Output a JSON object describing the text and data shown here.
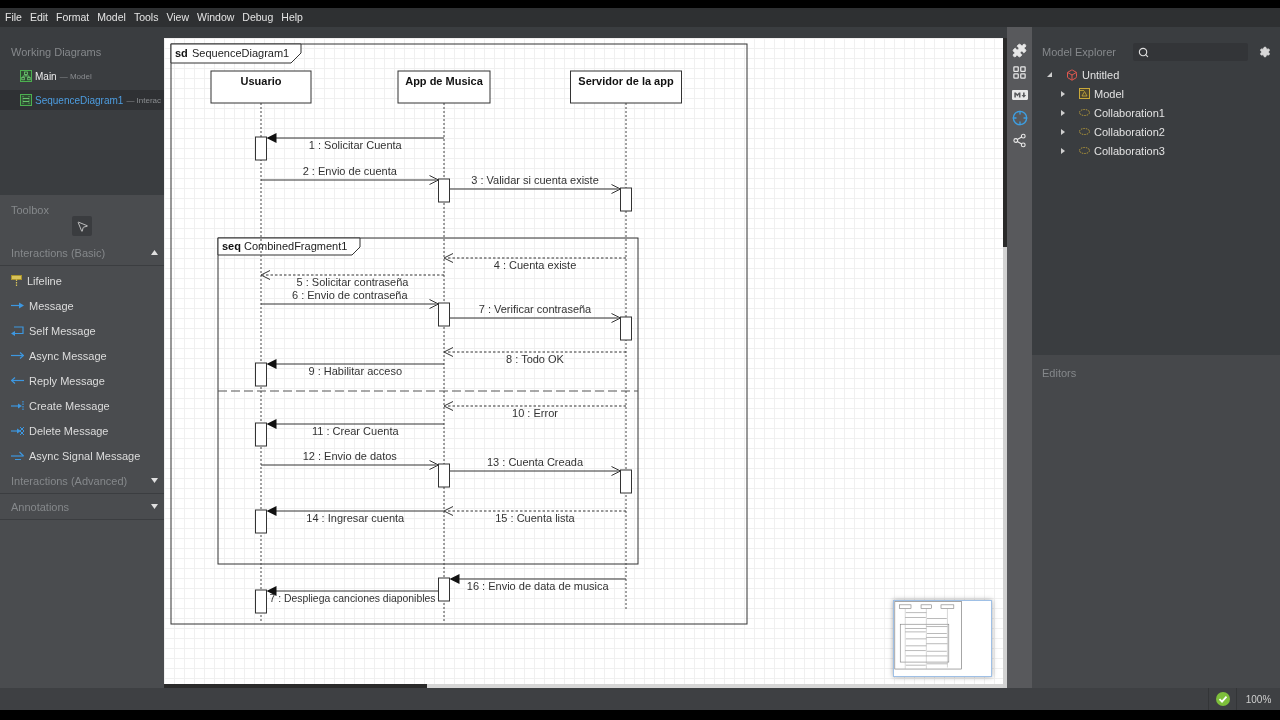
{
  "menu": [
    "File",
    "Edit",
    "Format",
    "Model",
    "Tools",
    "View",
    "Window",
    "Debug",
    "Help"
  ],
  "working_diagrams": {
    "title": "Working Diagrams",
    "items": [
      {
        "name": "Main",
        "type": "— Model",
        "kind": "model",
        "selected": false
      },
      {
        "name": "SequenceDiagram1",
        "type": "— Interac",
        "kind": "sequence",
        "selected": true
      }
    ]
  },
  "toolbox": {
    "title": "Toolbox",
    "sections": [
      {
        "title": "Interactions (Basic)",
        "expanded": true,
        "items": [
          {
            "label": "Lifeline",
            "kind": "lifeline"
          },
          {
            "label": "Message",
            "kind": "message"
          },
          {
            "label": "Self Message",
            "kind": "self"
          },
          {
            "label": "Async Message",
            "kind": "async"
          },
          {
            "label": "Reply Message",
            "kind": "reply"
          },
          {
            "label": "Create Message",
            "kind": "create"
          },
          {
            "label": "Delete Message",
            "kind": "delete"
          },
          {
            "label": "Async Signal Message",
            "kind": "signal"
          }
        ]
      },
      {
        "title": "Interactions (Advanced)",
        "expanded": false
      },
      {
        "title": "Annotations",
        "expanded": false
      }
    ]
  },
  "diagram": {
    "frame": {
      "keyword": "sd",
      "name": "SequenceDiagram1"
    },
    "lifelines": [
      {
        "name": "Usuario"
      },
      {
        "name": "App de Musica"
      },
      {
        "name": "Servidor de la app"
      }
    ],
    "fragment": {
      "keyword": "seq",
      "name": "CombinedFragment1"
    },
    "messages": [
      {
        "label": "1 : Solicitar Cuenta",
        "kind": "synch"
      },
      {
        "label": "2 : Envio de cuenta",
        "kind": "async"
      },
      {
        "label": "3 : Validar si cuenta existe",
        "kind": "async"
      },
      {
        "label": "4 : Cuenta existe",
        "kind": "reply"
      },
      {
        "label": "5 : Solicitar contraseña",
        "kind": "reply"
      },
      {
        "label": "6 : Envio de contraseña",
        "kind": "async"
      },
      {
        "label": "7 : Verificar contraseña",
        "kind": "async"
      },
      {
        "label": "8 : Todo OK",
        "kind": "reply"
      },
      {
        "label": "9 : Habilitar acceso",
        "kind": "synch"
      },
      {
        "label": "10 : Error",
        "kind": "reply"
      },
      {
        "label": "11 : Crear Cuenta",
        "kind": "synch"
      },
      {
        "label": "12 : Envio de datos",
        "kind": "async"
      },
      {
        "label": "13 : Cuenta Creada",
        "kind": "async"
      },
      {
        "label": "14 : Ingresar cuenta",
        "kind": "synch"
      },
      {
        "label": "15 : Cuenta lista",
        "kind": "reply"
      },
      {
        "label": "16 : Envio de data de musica",
        "kind": "synch"
      },
      {
        "label": "7 : Despliega canciones diaponibles",
        "kind": "synch"
      }
    ]
  },
  "right_toolbar": [
    {
      "kind": "extensions",
      "selected": false
    },
    {
      "kind": "layout",
      "selected": false
    },
    {
      "kind": "markdown",
      "selected": false
    },
    {
      "kind": "navigator",
      "selected": true
    },
    {
      "kind": "share",
      "selected": false
    }
  ],
  "model_explorer": {
    "title": "Model Explorer",
    "tree": [
      {
        "label": "Untitled",
        "kind": "project",
        "expanded": true,
        "children": [
          {
            "label": "Model",
            "kind": "model",
            "expanded": false
          },
          {
            "label": "Collaboration1",
            "kind": "collaboration",
            "expanded": false
          },
          {
            "label": "Collaboration2",
            "kind": "collaboration",
            "expanded": false
          },
          {
            "label": "Collaboration3",
            "kind": "collaboration",
            "expanded": false
          }
        ]
      }
    ]
  },
  "editors": {
    "title": "Editors"
  },
  "status_bar": {
    "zoom": "100%"
  }
}
